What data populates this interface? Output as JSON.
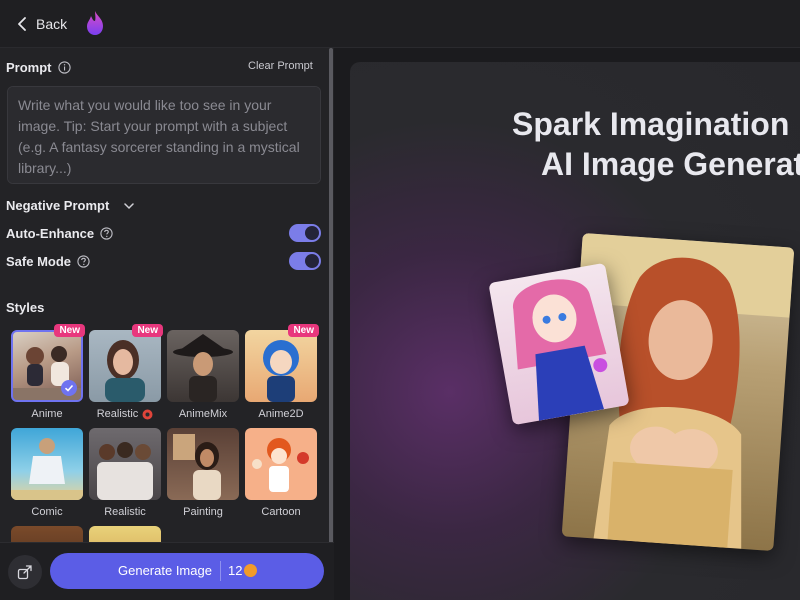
{
  "topbar": {
    "back_label": "Back"
  },
  "prompt": {
    "label": "Prompt",
    "clear_label": "Clear Prompt",
    "placeholder": "Write what you would like too see in your image. Tip: Start your prompt with a subject (e.g. A fantasy sorcerer standing in a mystical library...)"
  },
  "negative_prompt": {
    "label": "Negative Prompt"
  },
  "auto_enhance": {
    "label": "Auto-Enhance",
    "enabled": true
  },
  "safe_mode": {
    "label": "Safe Mode",
    "enabled": true
  },
  "styles": {
    "label": "Styles",
    "items": [
      {
        "name": "Anime",
        "badge": "New",
        "selected": true
      },
      {
        "name": "Realistic",
        "badge": "New",
        "selected": false
      },
      {
        "name": "AnimeMix",
        "badge": "",
        "selected": false
      },
      {
        "name": "Anime2D",
        "badge": "New",
        "selected": false
      },
      {
        "name": "Comic",
        "badge": "",
        "selected": false
      },
      {
        "name": "Realistic",
        "badge": "",
        "selected": false
      },
      {
        "name": "Painting",
        "badge": "",
        "selected": false
      },
      {
        "name": "Cartoon",
        "badge": "",
        "selected": false
      }
    ]
  },
  "generate": {
    "label": "Generate Image",
    "cost": "12"
  },
  "hero": {
    "title_line1": "Spark Imagination",
    "title_line2": "AI Image Generat"
  },
  "colors": {
    "accent": "#5b5de6",
    "badge": "#e8377d",
    "coin": "#f29b2a"
  }
}
